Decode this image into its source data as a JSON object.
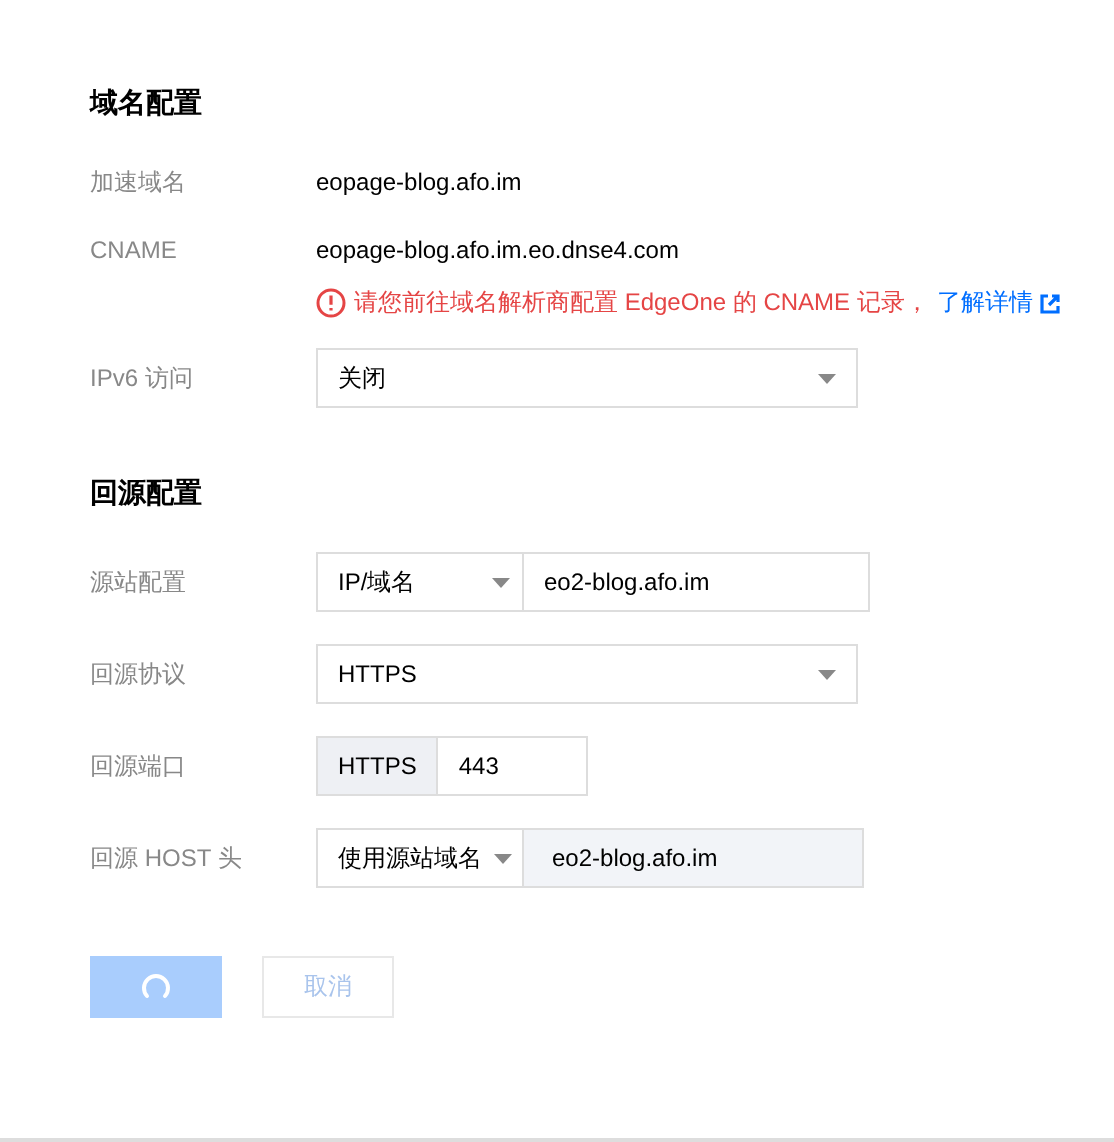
{
  "sections": [
    {
      "title": "域名配置",
      "rows": [
        {
          "kind": "text",
          "label": "加速域名",
          "value": "eopage-blog.afo.im"
        },
        {
          "kind": "text",
          "label": "CNAME",
          "value": "eopage-blog.afo.im.eo.dnse4.com",
          "warning": {
            "text": "请您前往域名解析商配置 EdgeOne 的 CNAME 记录，",
            "link": "了解详情"
          }
        },
        {
          "kind": "select",
          "label": "IPv6 访问",
          "value": "关闭"
        }
      ]
    },
    {
      "title": "回源配置",
      "rows": [
        {
          "kind": "split",
          "label": "源站配置",
          "select": "IP/域名",
          "value": "eo2-blog.afo.im"
        },
        {
          "kind": "select",
          "label": "回源协议",
          "value": "HTTPS"
        },
        {
          "kind": "addon",
          "label": "回源端口",
          "addon": "HTTPS",
          "value": "443"
        },
        {
          "kind": "split-readonly",
          "label": "回源 HOST 头",
          "select": "使用源站域名",
          "value": "eo2-blog.afo.im"
        }
      ]
    }
  ],
  "buttons": [
    {
      "kind": "primary",
      "loading": true,
      "disabled": true
    },
    {
      "kind": "secondary",
      "label": "取消",
      "disabled": true
    }
  ]
}
